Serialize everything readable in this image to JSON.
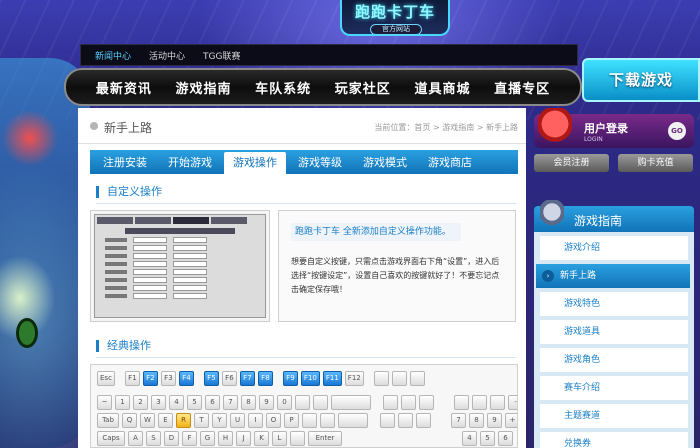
{
  "logo": {
    "title": "跑跑卡丁车",
    "subtitle": "官方网站"
  },
  "topnav": [
    "新闻中心",
    "活动中心",
    "TGG联赛"
  ],
  "mainnav": [
    "最新资讯",
    "游戏指南",
    "车队系统",
    "玩家社区",
    "道具商城",
    "直播专区"
  ],
  "download_label": "下载游戏",
  "main": {
    "page_title": "新手上路",
    "breadcrumb": "当前位置：首页 > 游戏指南 > 新手上路",
    "tabs": [
      "注册安装",
      "开始游戏",
      "游戏操作",
      "游戏等级",
      "游戏模式",
      "游戏商店"
    ],
    "active_tab": "游戏操作",
    "section_custom": "自定义操作",
    "section_classic": "经典操作",
    "info_title": "跑跑卡丁车 全新添加自定义操作功能。",
    "info_text": "想要自定义按键，只需点击游戏界面右下角“设置”，进入后选择“按键设定”，设置自己喜欢的按键就好了！不要忘记点击确定保存哦！"
  },
  "keyboard": {
    "row1": [
      "Esc",
      "F1",
      "F2",
      "F3",
      "F4",
      "F5",
      "F6",
      "F7",
      "F8",
      "F9",
      "F10",
      "F11",
      "F12"
    ],
    "row1_highlight": [
      "F2",
      "F4",
      "F5",
      "F7",
      "F8",
      "F9",
      "F10",
      "F11"
    ],
    "row2": [
      "~",
      "1",
      "2",
      "3",
      "4",
      "5",
      "6",
      "7",
      "8",
      "9",
      "0"
    ],
    "row3": [
      "Tab",
      "Q",
      "W",
      "E",
      "R",
      "T",
      "Y",
      "U",
      "I",
      "O",
      "P"
    ],
    "row3_yellow": [
      "R"
    ],
    "row4": [
      "Caps",
      "A",
      "S",
      "D",
      "F",
      "G",
      "H",
      "J",
      "K",
      "L",
      "Enter"
    ],
    "numpad": [
      "-",
      "7",
      "8",
      "9",
      "+",
      "4",
      "5",
      "6"
    ]
  },
  "sidebar": {
    "login_title": "用户登录",
    "login_sub": "LOGIN",
    "go_label": "GO",
    "register_label": "会员注册",
    "buycard_label": "购卡充值",
    "guide_title": "游戏指南",
    "guide_items": [
      "游戏介绍",
      "新手上路",
      "游戏特色",
      "游戏道具",
      "游戏角色",
      "赛车介绍",
      "主题赛道",
      "兑换券"
    ],
    "active_item": "新手上路"
  },
  "colors": {
    "accent": "#1a7fc7",
    "nav_bg": "#0d0d0d",
    "download": "#0a8fc8"
  }
}
